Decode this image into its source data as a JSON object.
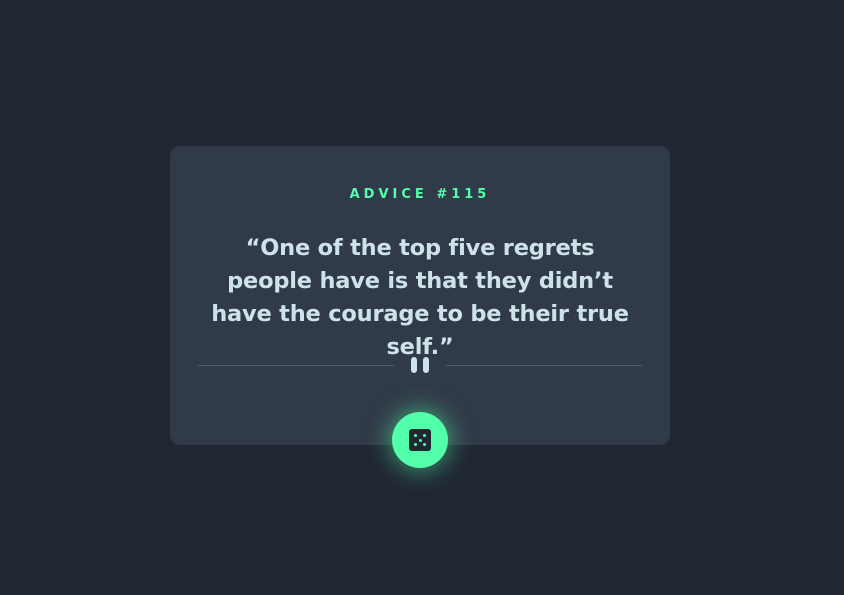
{
  "advice": {
    "id_label": "ADVICE #115",
    "text": "“One of the top five regrets people have is that they didn’t have the courage to be their true self.”"
  },
  "colors": {
    "background": "#202733",
    "card": "#313a48",
    "accent": "#53ffaa",
    "text": "#cee3e9",
    "divider": "#4f5d74"
  },
  "icons": {
    "divider_icon": "pause-icon",
    "button_icon": "dice-icon"
  }
}
